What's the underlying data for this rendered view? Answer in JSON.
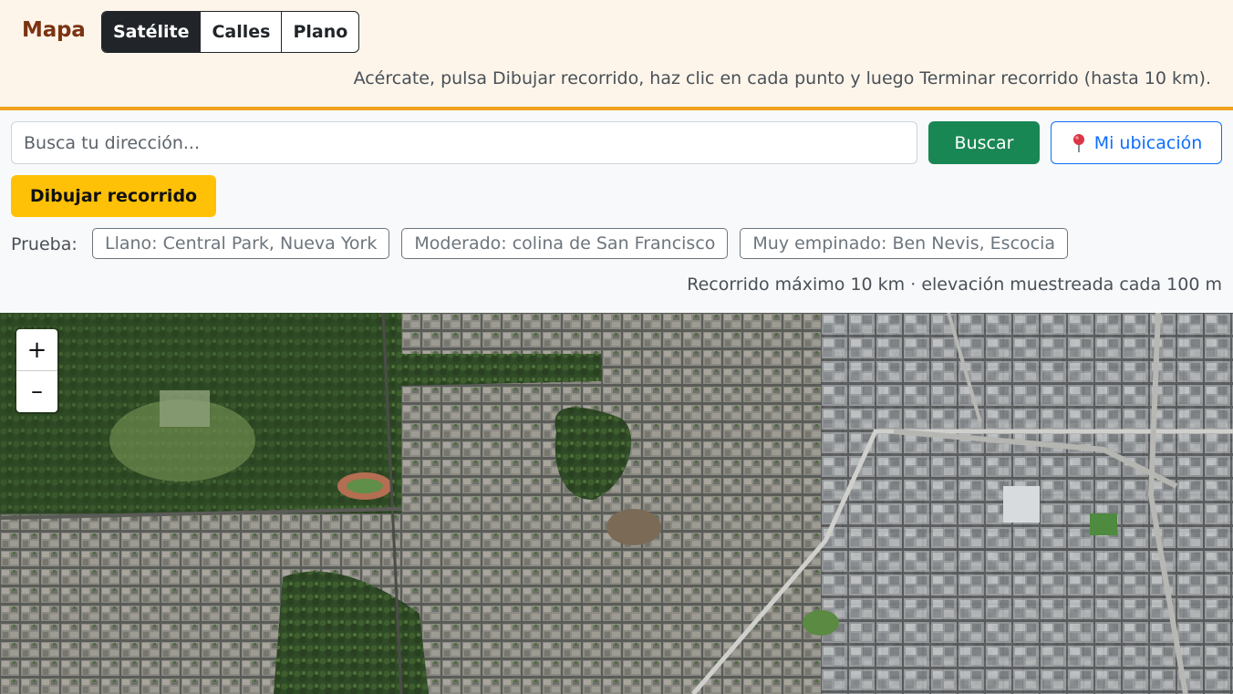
{
  "header": {
    "brand": "Mapa",
    "layers": [
      {
        "label": "Satélite",
        "active": true
      },
      {
        "label": "Calles",
        "active": false
      },
      {
        "label": "Plano",
        "active": false
      }
    ],
    "hint": "Acércate, pulsa Dibujar recorrido, haz clic en cada punto y luego Terminar recorrido (hasta 10 km)."
  },
  "search": {
    "placeholder": "Busca tu dirección...",
    "value": "",
    "search_label": "Buscar",
    "location_label": "Mi ubicación",
    "location_icon": "map-pin-icon"
  },
  "draw": {
    "label": "Dibujar recorrido"
  },
  "examples": {
    "label": "Prueba:",
    "items": [
      "Llano: Central Park, Nueva York",
      "Moderado: colina de San Francisco",
      "Muy empinado: Ben Nevis, Escocia"
    ]
  },
  "meta": "Recorrido máximo 10 km · elevación muestreada cada 100 m",
  "map": {
    "zoom_in": "+",
    "zoom_out": "–",
    "colors": {
      "accent": "#f0a21b",
      "brand": "#7b3312",
      "search": "#198754",
      "location": "#0d6efd",
      "draw": "#ffc107"
    }
  }
}
